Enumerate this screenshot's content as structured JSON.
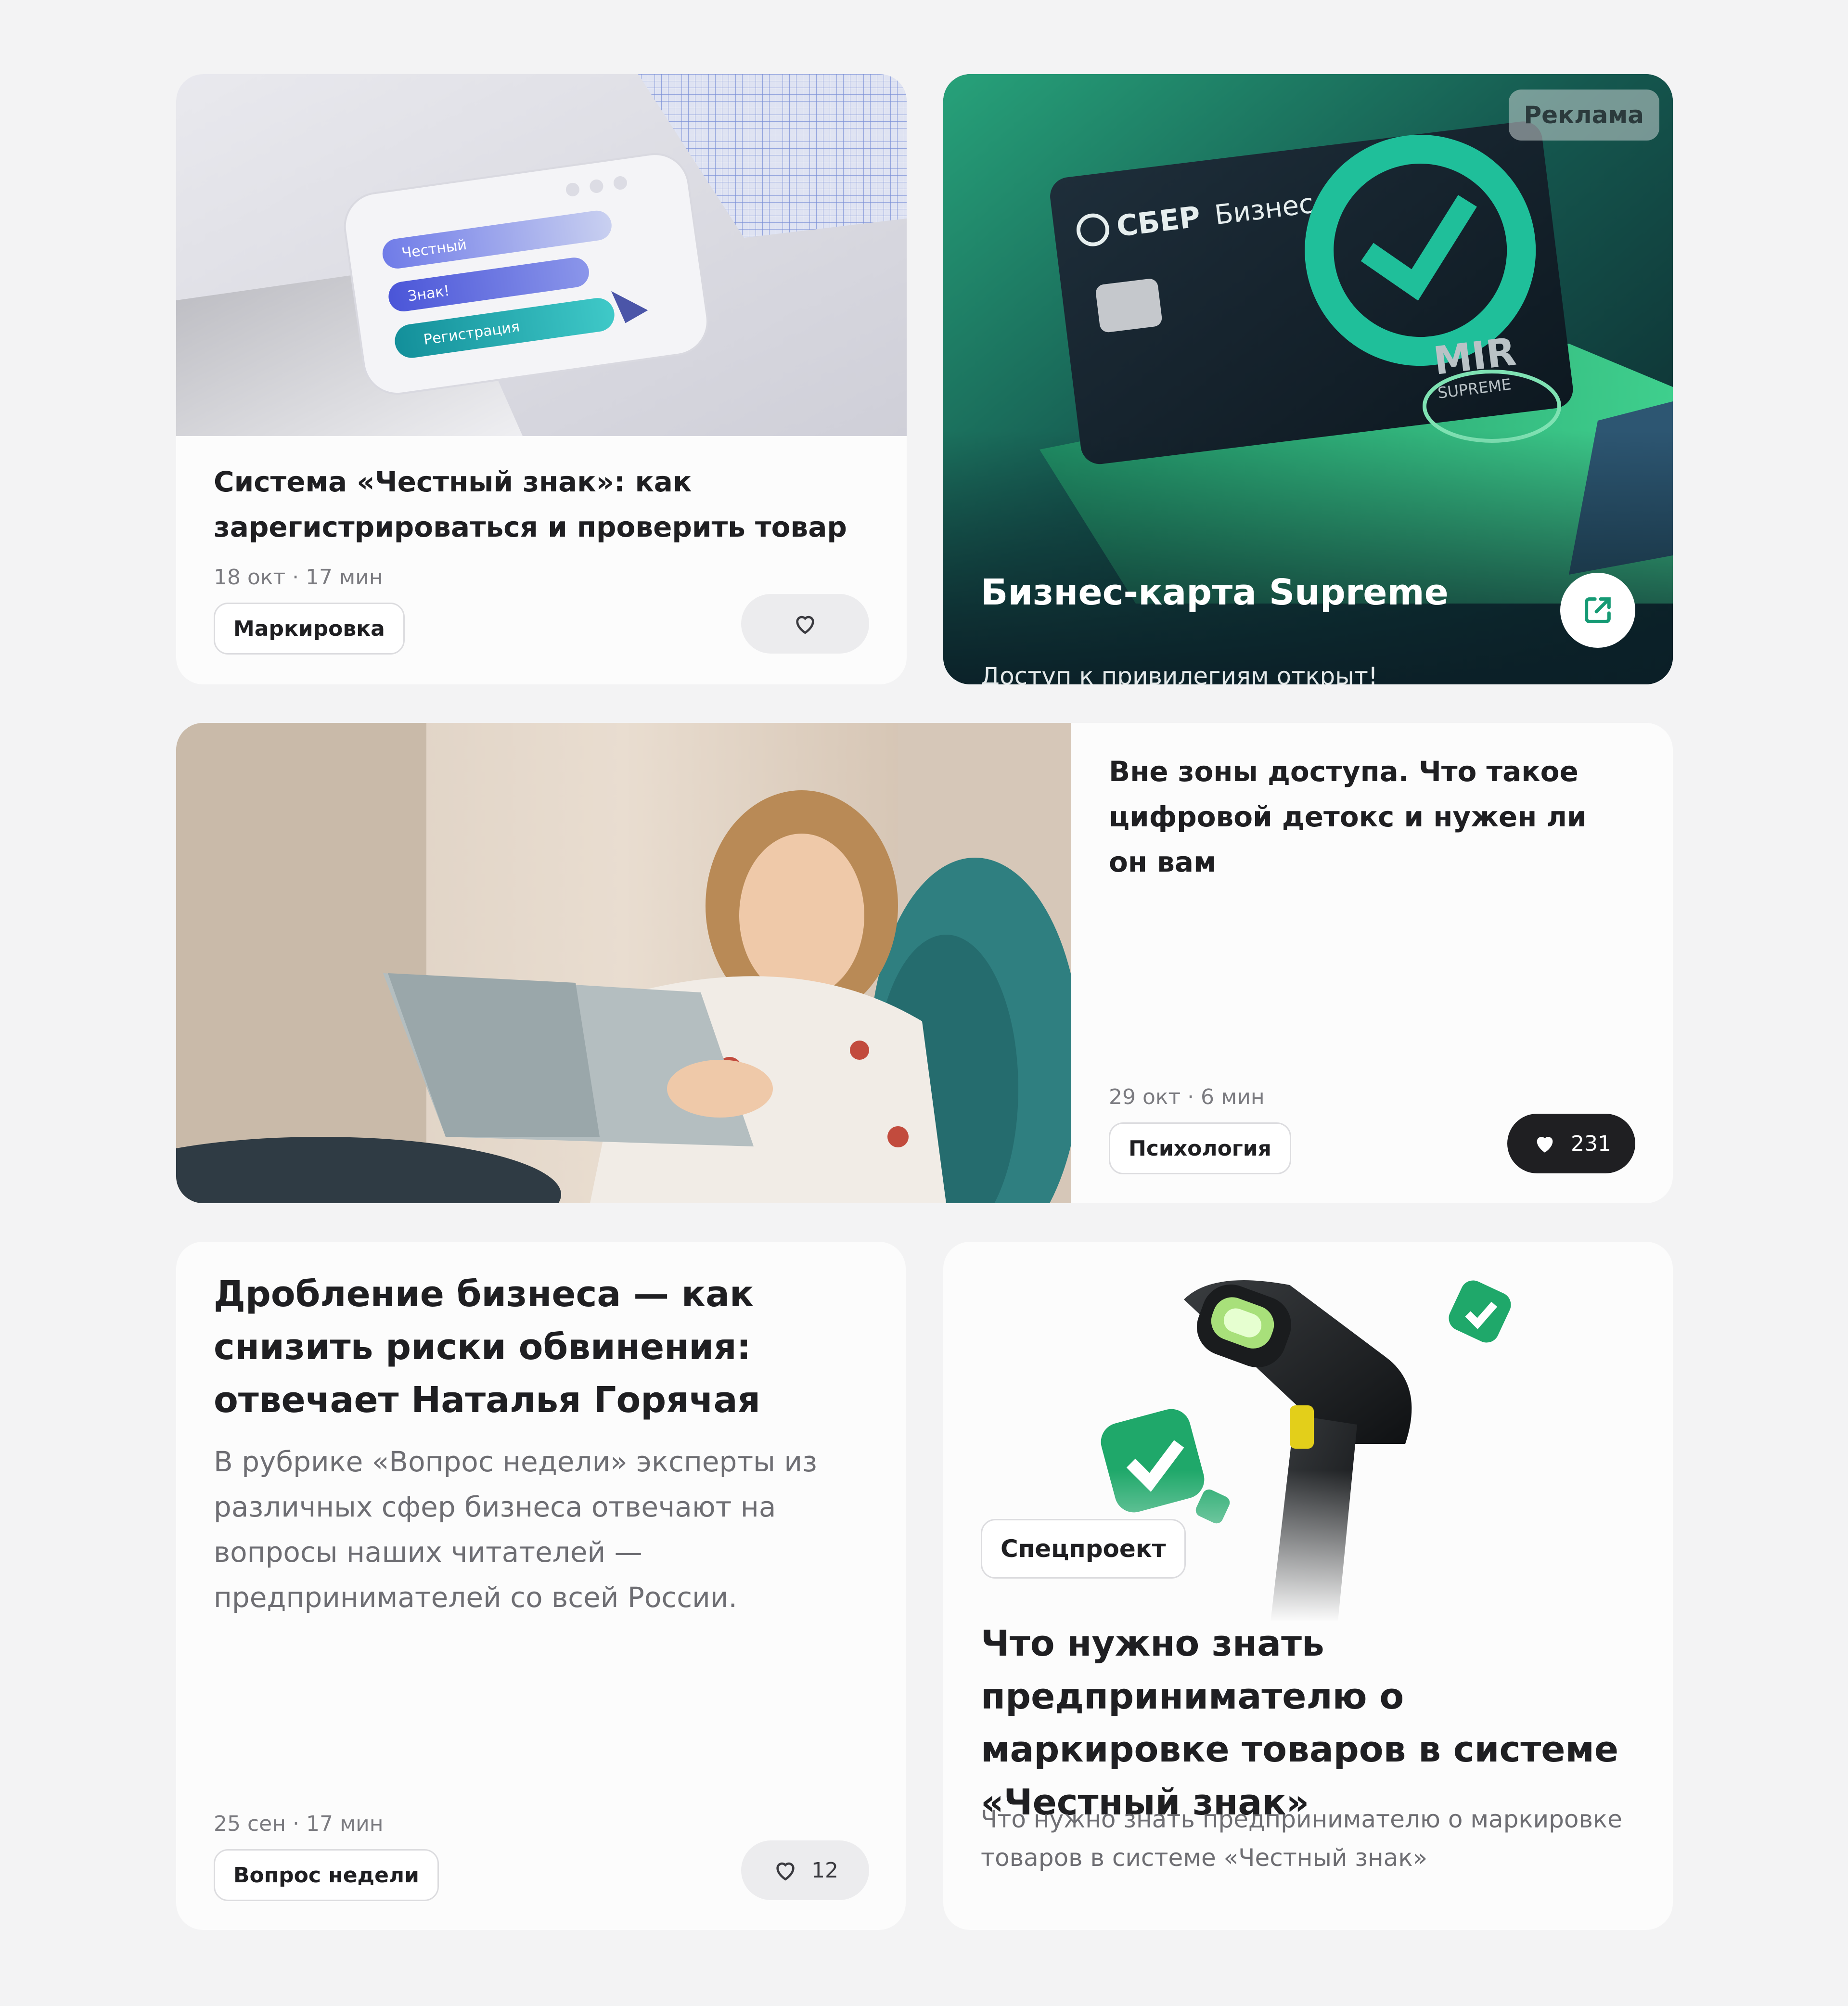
{
  "cards": [
    {
      "title": "Система «Честный знак»: как зарегистрироваться и проверить товар",
      "meta": "18 окт · 17 мин",
      "tag": "Маркировка",
      "likes": "",
      "image_texts": [
        "Честный",
        "Знак!",
        "Регистрация"
      ]
    },
    {
      "badge": "Реклама",
      "title": "Бизнес-карта Supreme",
      "subtitle": "Доступ к привилегиям открыт!",
      "image_texts": {
        "brand": "СБЕР",
        "brand_sub": "Бизнес",
        "mir": "MIR",
        "mir_sub": "SUPREME"
      }
    },
    {
      "title": "Вне зоны доступа. Что такое цифровой детокс и нужен ли он вам",
      "meta": "29 окт · 6 мин",
      "tag": "Психология",
      "likes": "231"
    },
    {
      "title": "Дробление бизнеса — как снизить риски обвинения: отвечает Наталья Горячая",
      "description": "В рубрике «Вопрос недели» эксперты из различных сфер бизнеса отвечают на вопросы наших читателей — предпринимателей со всей России.",
      "meta": "25 сен · 17 мин",
      "tag": "Вопрос недели",
      "likes": "12"
    },
    {
      "tag": "Спецпроект",
      "title": "Что нужно знать предпринимателю о маркировке товаров в системе «Честный знак»",
      "description": "Что нужно знать предпринимателю о маркировке товаров в системе «Честный знак»"
    }
  ],
  "colors": {
    "page_bg": "#f3f3f4",
    "card_bg": "#fcfcfc",
    "accent_green": "#21a038",
    "dark_button": "#1f1f22"
  },
  "icons": [
    "heart-outline-icon",
    "heart-filled-icon",
    "external-link-icon"
  ]
}
